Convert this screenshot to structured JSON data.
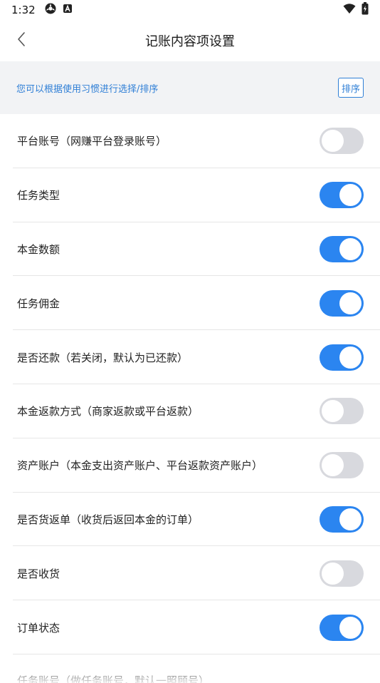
{
  "status_bar": {
    "time": "1:32",
    "icons": [
      "settings-gear-icon",
      "app-a-icon"
    ],
    "right_icons": [
      "wifi-icon",
      "battery-icon"
    ]
  },
  "nav": {
    "title": "记账内容项设置",
    "back_icon": "chevron-left-icon"
  },
  "tip": {
    "text": "您可以根据使用习惯进行选择/排序",
    "sort_label": "排序"
  },
  "settings": [
    {
      "label": "平台账号（网赚平台登录账号）",
      "on": false
    },
    {
      "label": "任务类型",
      "on": true
    },
    {
      "label": "本金数额",
      "on": true
    },
    {
      "label": "任务佣金",
      "on": true
    },
    {
      "label": "是否还款（若关闭，默认为已还款）",
      "on": true
    },
    {
      "label": "本金返款方式（商家返款或平台返款）",
      "on": false
    },
    {
      "label": "资产账户（本金支出资产账户、平台返款资产账户）",
      "on": false
    },
    {
      "label": "是否货返单（收货后返回本金的订单）",
      "on": true
    },
    {
      "label": "是否收货",
      "on": false
    },
    {
      "label": "订单状态",
      "on": true
    }
  ],
  "partial_row_label": "任务账号（做任务账号，默认一照顾号）",
  "colors": {
    "accent": "#2b85f0",
    "tip_text": "#2f7fd6",
    "toggle_off": "#d8d9de",
    "banner_bg": "#f2f3f5"
  }
}
